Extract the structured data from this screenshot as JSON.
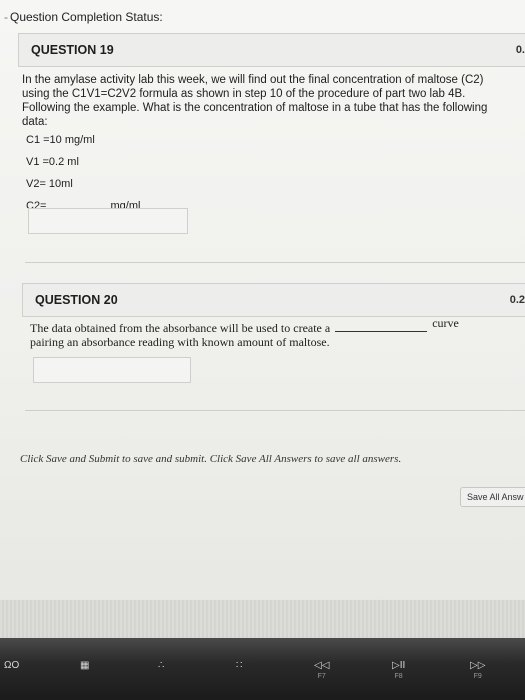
{
  "status": {
    "label": "Question Completion Status:"
  },
  "q19": {
    "title": "QUESTION 19",
    "points": "0.",
    "text": "In the amylase activity lab this week, we will find out the final concentration of maltose (C2) using the C1V1=C2V2 formula as shown in step 10 of the procedure of part two lab 4B. Following the example. What is the concentration of maltose in a tube that has the following data:",
    "data": [
      "C1 =10 mg/ml",
      "V1 =0.2 ml",
      "V2= 10ml"
    ],
    "c2_label": "C2=",
    "c2_unit": "mg/ml"
  },
  "q20": {
    "title": "QUESTION 20",
    "points": "0.2",
    "text_before": "The data obtained from the absorbance will be used to create a",
    "text_after": "curve",
    "text_line2": "pairing an absorbance reading with known amount of maltose."
  },
  "footer": {
    "note": "Click Save and Submit to save and submit. Click Save All Answers to save all answers.",
    "save_all_label": "Save All Answ"
  },
  "keyboard": {
    "keys": [
      {
        "glyph": "ΩO",
        "sub": ""
      },
      {
        "glyph": "▦",
        "sub": ""
      },
      {
        "glyph": "∴",
        "sub": ""
      },
      {
        "glyph": "∷",
        "sub": ""
      },
      {
        "glyph": "◁◁",
        "sub": "F7"
      },
      {
        "glyph": "▷II",
        "sub": "F8"
      },
      {
        "glyph": "▷▷",
        "sub": "F9"
      }
    ]
  }
}
